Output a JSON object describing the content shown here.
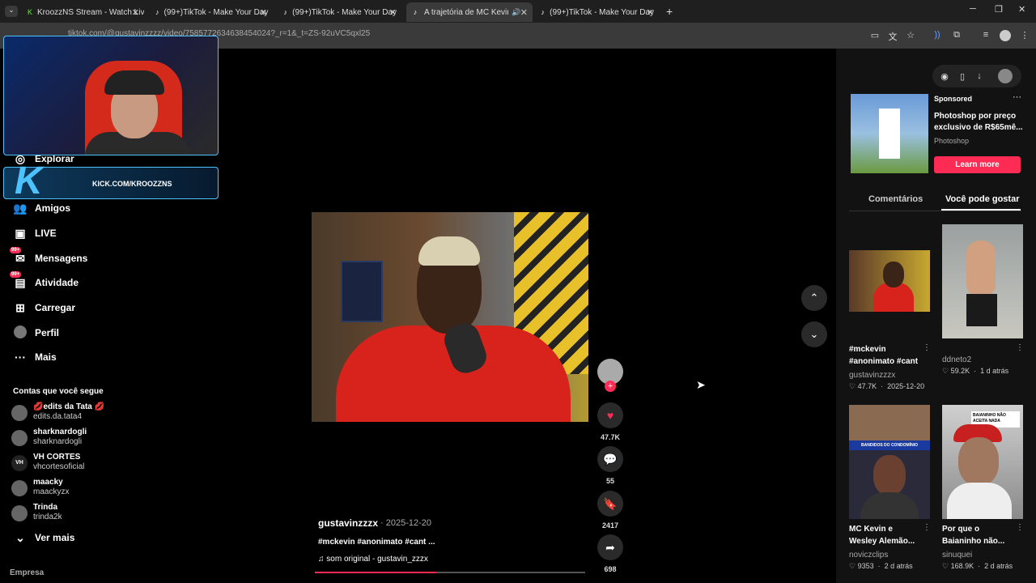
{
  "browser": {
    "tabs": [
      {
        "label": "KroozzNS Stream - Watch Live",
        "favicon": "kick-icon",
        "active": false
      },
      {
        "label": "(99+)TikTok - Make Your Day",
        "favicon": "tiktok-icon",
        "active": false
      },
      {
        "label": "(99+)TikTok - Make Your Day",
        "favicon": "tiktok-icon",
        "active": false
      },
      {
        "label": "A trajetória de MC Kevin: D",
        "favicon": "tiktok-icon",
        "active": true
      },
      {
        "label": "(99+)TikTok - Make Your Day",
        "favicon": "tiktok-icon",
        "active": false
      }
    ],
    "url": "tiktok.com/@gustavinzzzz/video/7585772634638454024?_r=1&_t=ZS-92uVC5qxl25"
  },
  "overlay": {
    "kick_text": "KICK.COM/KROOZZNS"
  },
  "sidebar": {
    "nav": [
      {
        "label": "Explorar",
        "icon": "compass-icon"
      },
      {
        "label": "Amigos",
        "icon": "friends-icon"
      },
      {
        "label": "LIVE",
        "icon": "live-icon"
      },
      {
        "label": "Mensagens",
        "icon": "messages-icon",
        "badge": "99+"
      },
      {
        "label": "Atividade",
        "icon": "activity-icon",
        "badge": "99+"
      },
      {
        "label": "Carregar",
        "icon": "upload-icon"
      },
      {
        "label": "Perfil",
        "icon": "profile-icon"
      },
      {
        "label": "Mais",
        "icon": "more-icon"
      }
    ],
    "following_title": "Contas que você segue",
    "following": [
      {
        "name": "💋edits da Tata 💋",
        "handle": "edits.da.tata4"
      },
      {
        "name": "sharknardogli",
        "handle": "sharknardogli"
      },
      {
        "name": "VH CORTES",
        "handle": "vhcortesoficial"
      },
      {
        "name": "maacky",
        "handle": "maackyzx"
      },
      {
        "name": "Trinda",
        "handle": "trinda2k"
      }
    ],
    "see_more": "Ver mais",
    "footer": "Empresa"
  },
  "video": {
    "author": "gustavinzzzx",
    "date": "· 2025-12-20",
    "description": "#mckevin #anonimato #cant ...",
    "sound": "som original - gustavin_zzzx",
    "likes": "47.7K",
    "comments": "55",
    "saves": "2417",
    "shares": "698",
    "progress": 0.45
  },
  "right": {
    "ad": {
      "sponsored": "Sponsored",
      "title": "Photoshop por preço exclusivo de R$65mê...",
      "brand": "Photoshop",
      "cta": "Learn more"
    },
    "tabs": [
      "Comentários",
      "Você pode gostar"
    ],
    "cards": [
      {
        "title": "#mckevin #anonimato #cant",
        "author": "gustavinzzzx",
        "views": "47.7K",
        "date": "2025-12-20"
      },
      {
        "title": "",
        "author": "ddneto2",
        "views": "59.2K",
        "date": "1 d atrás"
      },
      {
        "title": "MC Kevin e Wesley Alemão...",
        "author": "noviczclips",
        "views": "9353",
        "date": "2 d atrás"
      },
      {
        "title": "Por que o Baianinho não...",
        "author": "sinuquei",
        "views": "168.9K",
        "date": "2 d atrás"
      }
    ],
    "thumb_texts": {
      "condominio": "BANDIDOS DO CONDOMÍNIO",
      "aceita": "BAIANINHO NÃO ACEITA NADA"
    }
  }
}
